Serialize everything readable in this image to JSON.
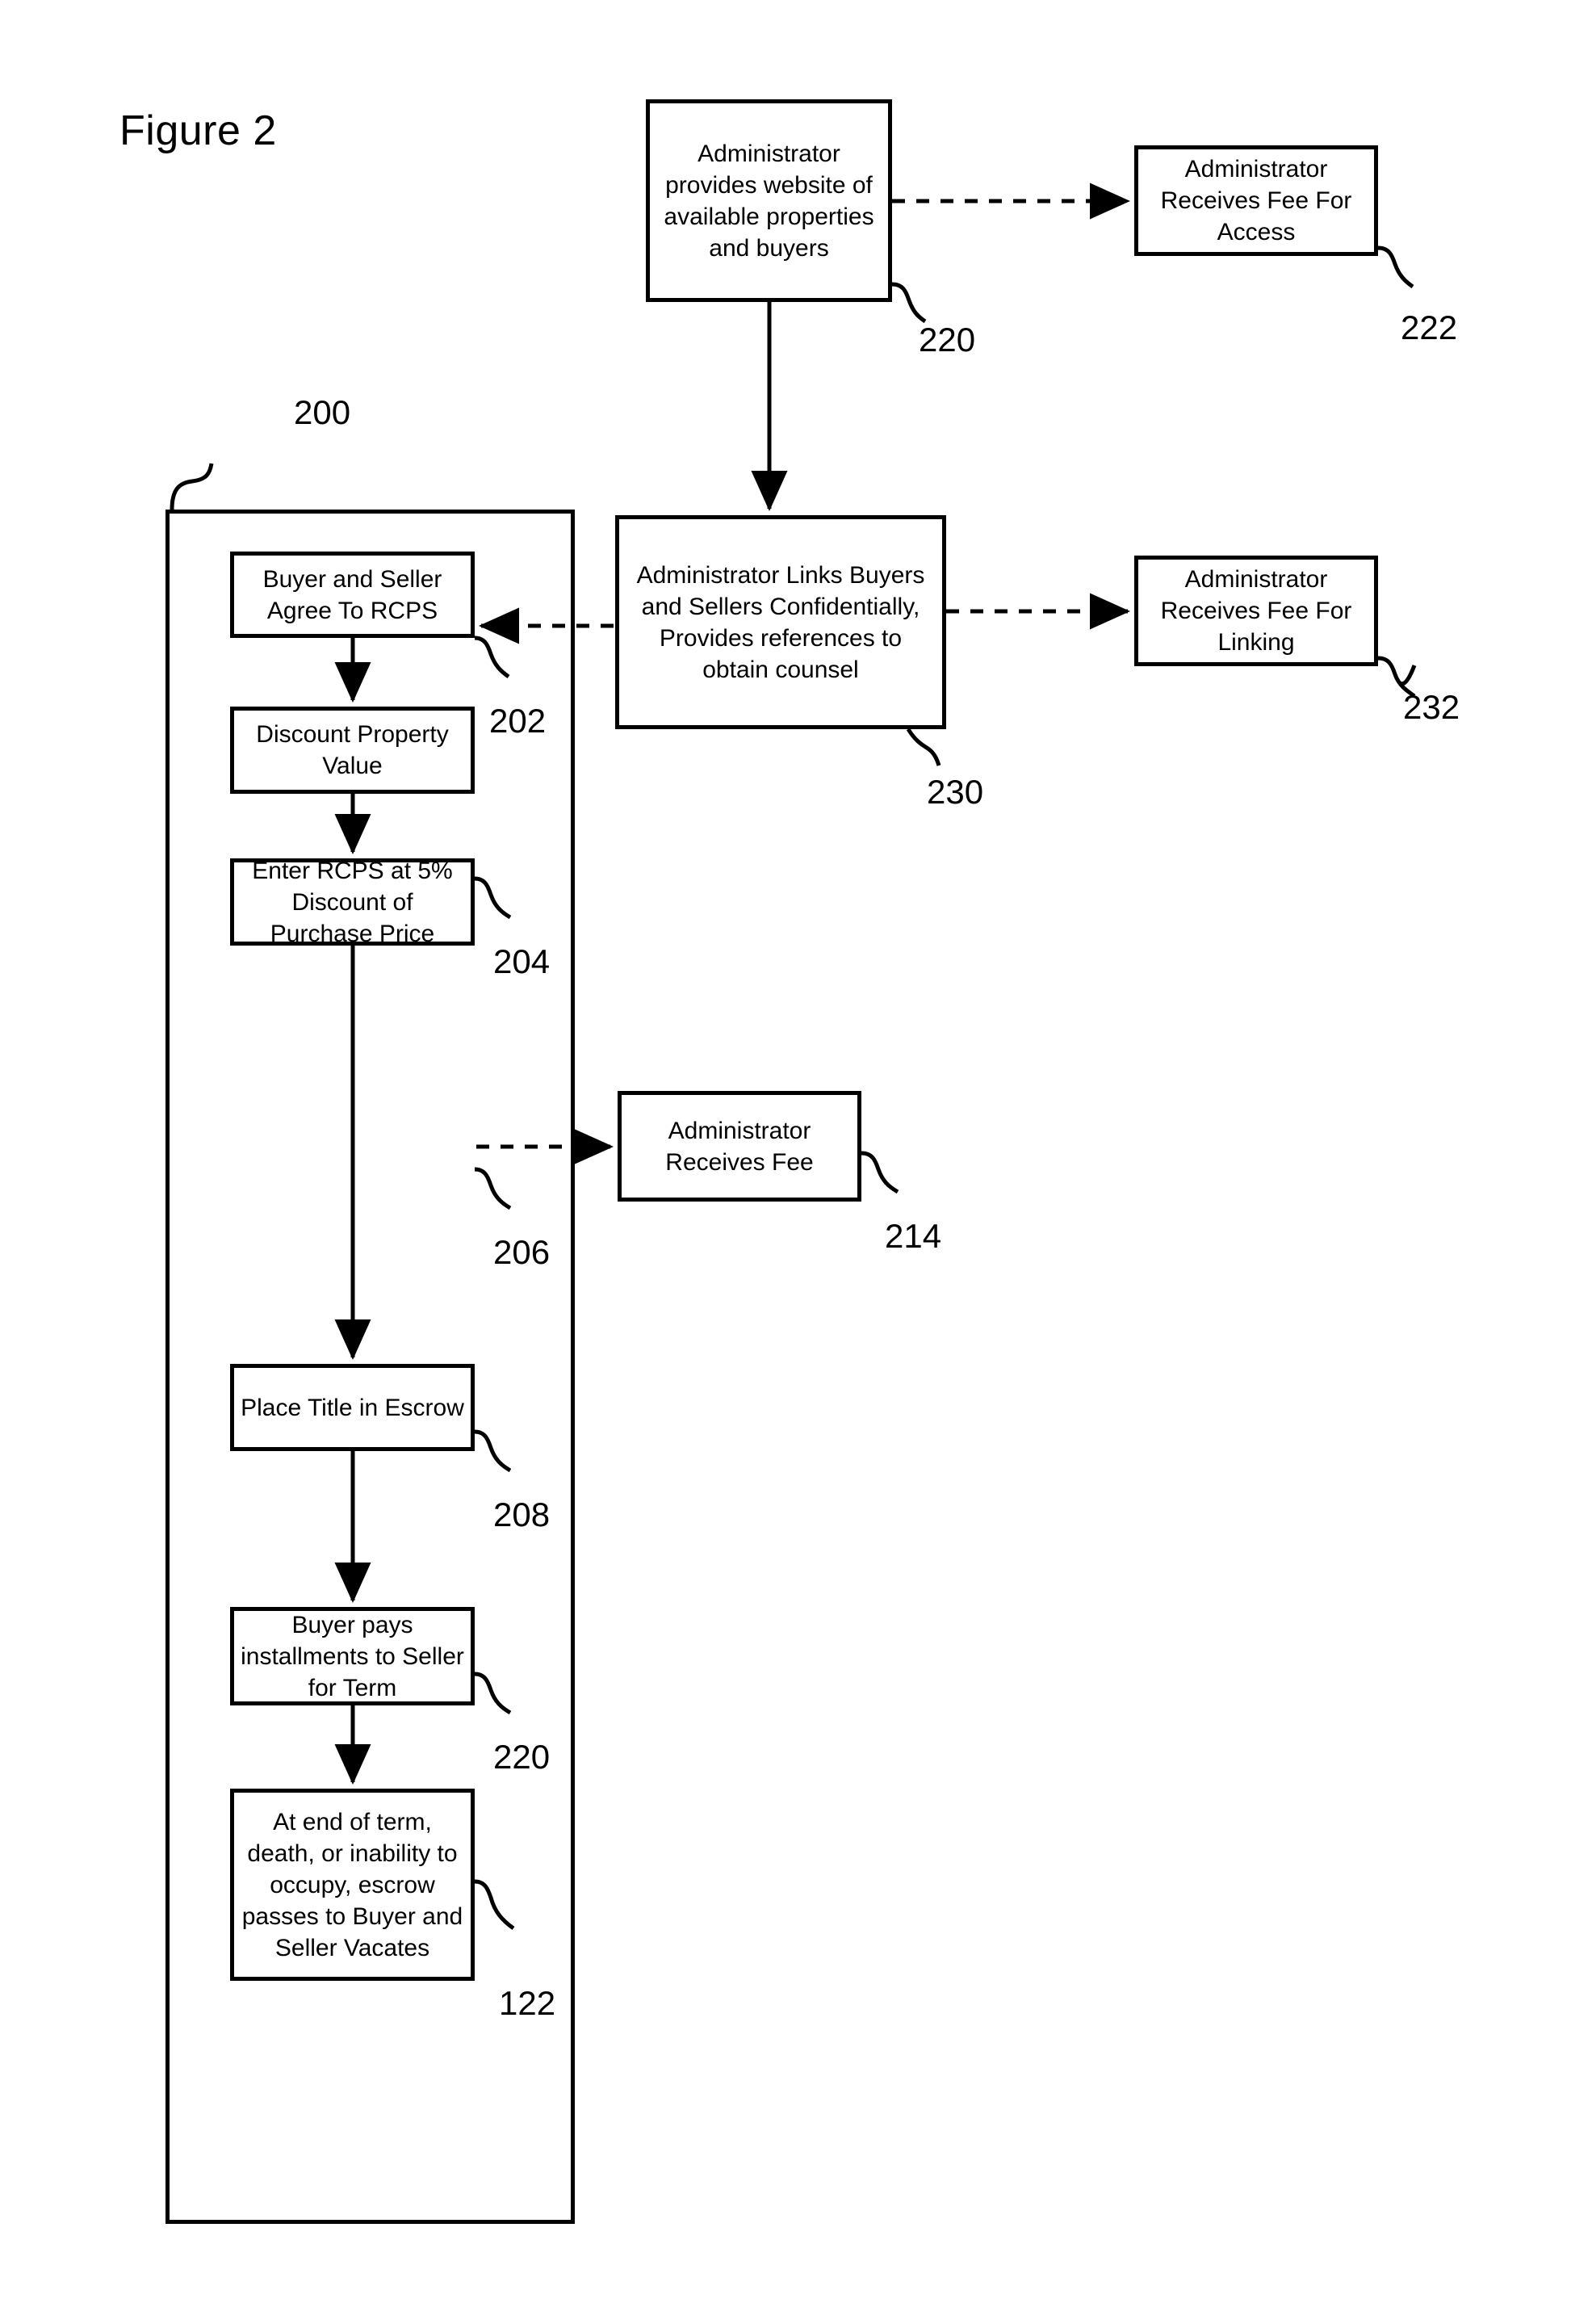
{
  "figure": {
    "title": "Figure 2"
  },
  "container": {
    "ref": "200"
  },
  "boxes": {
    "website": {
      "text": "Administrator provides website of available properties and buyers",
      "ref": "220"
    },
    "fee_access": {
      "text": "Administrator Receives Fee For Access",
      "ref": "222"
    },
    "links": {
      "text": "Administrator Links Buyers and Sellers Confidentially, Provides references to obtain counsel",
      "ref": "230"
    },
    "fee_linking": {
      "text": "Administrator Receives Fee For Linking",
      "ref": "232"
    },
    "agree": {
      "text": "Buyer and Seller Agree To RCPS",
      "ref": "202"
    },
    "discount": {
      "text": "Discount Property Value",
      "ref": "204"
    },
    "enter_rcps": {
      "text": "Enter RCPS at 5% Discount of Purchase Price",
      "ref": "206"
    },
    "fee": {
      "text": "Administrator Receives Fee",
      "ref": "214"
    },
    "escrow": {
      "text": "Place Title in Escrow",
      "ref": "208"
    },
    "installments": {
      "text": "Buyer pays installments to Seller for Term",
      "ref": "220"
    },
    "end_term": {
      "text": "At end of term, death, or inability to occupy, escrow passes to Buyer and Seller Vacates",
      "ref": "122"
    }
  },
  "colors": {
    "ink": "#000000",
    "paper": "#ffffff"
  }
}
